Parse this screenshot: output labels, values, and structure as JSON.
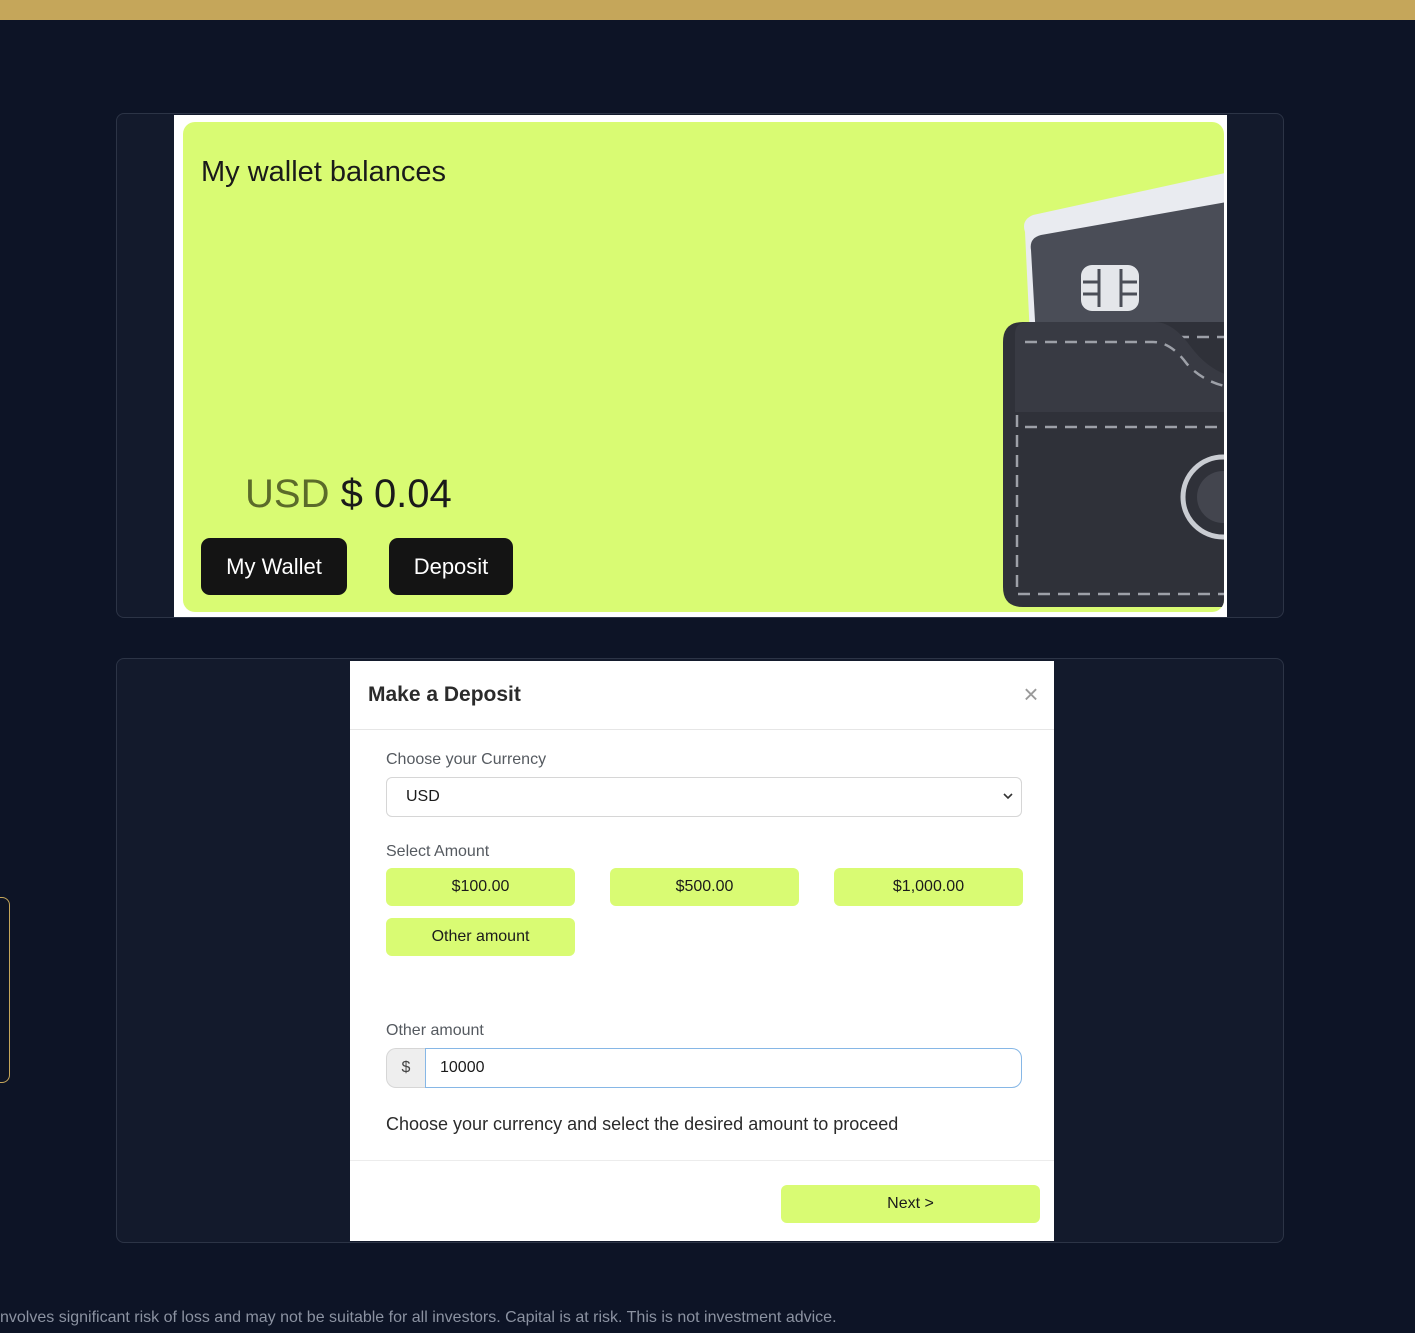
{
  "wallet": {
    "title": "My wallet balances",
    "currency": "USD",
    "amount": "$ 0.04",
    "my_wallet_label": "My Wallet",
    "deposit_label": "Deposit"
  },
  "deposit_modal": {
    "title": "Make a Deposit",
    "close_symbol": "×",
    "currency_label": "Choose your Currency",
    "currency_selected": "USD",
    "amount_label": "Select Amount",
    "amounts": [
      "$100.00",
      "$500.00",
      "$1,000.00"
    ],
    "other_amount_button": "Other amount",
    "other_amount_label": "Other amount",
    "other_amount_prefix": "$",
    "other_amount_value": "10000",
    "helper_text": "Choose your currency and select the desired amount to proceed",
    "next_label": "Next >"
  },
  "footer": {
    "disclaimer": "nvolves significant risk of loss and may not be suitable for all investors. Capital is at risk. This is not investment advice."
  },
  "colors": {
    "background": "#0d1426",
    "top_bar": "#c5a65a",
    "accent": "#d9fb73",
    "dark_button": "#141414"
  }
}
